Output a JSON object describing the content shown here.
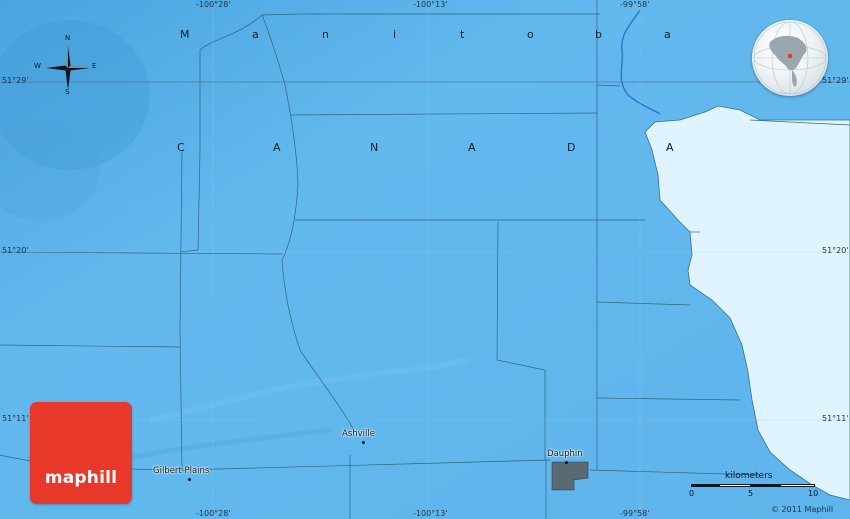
{
  "map": {
    "region_letters": [
      "M",
      "a",
      "n",
      "i",
      "t",
      "o",
      "b",
      "a"
    ],
    "country_letters": [
      "C",
      "A",
      "N",
      "A",
      "D",
      "A"
    ],
    "longitude_labels_top": [
      "-100°28'",
      "-100°13'",
      "-99°58'"
    ],
    "longitude_labels_bottom": [
      "-100°28'",
      "-100°13'",
      "-99°58'"
    ],
    "latitude_labels_left": [
      "51°29'",
      "51°20'",
      "51°11'"
    ],
    "latitude_labels_right": [
      "51°29'",
      "51°20'",
      "51°11'"
    ],
    "places": [
      "Ashville",
      "Dauphin",
      "Gilbert Plains"
    ],
    "compass": {
      "n": "N",
      "s": "S",
      "e": "E",
      "w": "W"
    },
    "scale": {
      "title": "kilometers",
      "ticks": [
        "0",
        "5",
        "10"
      ]
    },
    "brand": "maphill",
    "copyright": "© 2011 Maphill",
    "colors": {
      "land": "#5bb3ea",
      "lake": "#dff4fe",
      "boundary": "#2f5a78",
      "logo": "#e8382a",
      "town": "#5a6a74"
    }
  }
}
